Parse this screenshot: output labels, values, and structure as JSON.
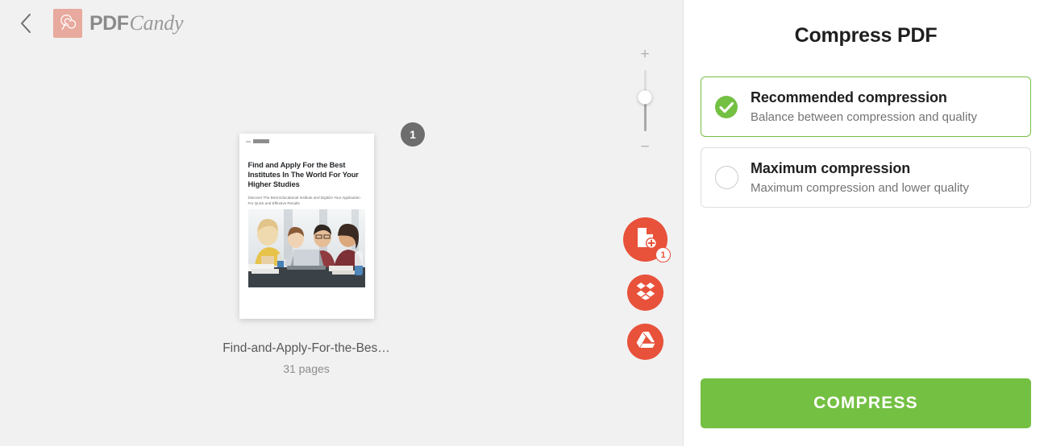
{
  "header": {
    "back_icon": "chevron-left-icon",
    "logo_icon": "lollipop-icon",
    "brand_bold": "PDF",
    "brand_italic": "Candy"
  },
  "workspace": {
    "page_badge": "1",
    "document": {
      "thumbnail_title": "Find and Apply For the Best Institutes In The World For Your Higher Studies",
      "thumbnail_subtitle": "Discover The Best Educational Institute and Digitize Your Application For Quick and Effective Results",
      "file_name": "Find-and-Apply-For-the-Bes…",
      "page_count": "31 pages"
    },
    "zoom": {
      "increase_label": "+",
      "decrease_label": "−",
      "increase_icon": "plus-icon",
      "decrease_icon": "minus-icon",
      "handle_position_percent": 45
    },
    "actions": [
      {
        "name": "add-file-button",
        "icon": "file-plus-icon",
        "badge": "1"
      },
      {
        "name": "dropbox-button",
        "icon": "dropbox-icon",
        "badge": ""
      },
      {
        "name": "google-drive-button",
        "icon": "google-drive-icon",
        "badge": ""
      }
    ]
  },
  "panel": {
    "title": "Compress PDF",
    "options": [
      {
        "title": "Recommended compression",
        "description": "Balance between compression and quality",
        "selected": true,
        "icon": "check-circle-icon"
      },
      {
        "title": "Maximum compression",
        "description": "Maximum compression and lower quality",
        "selected": false,
        "icon": "radio-unchecked-icon"
      }
    ],
    "cta_label": "COMPRESS"
  },
  "colors": {
    "accent_green": "#74c043",
    "accent_orange": "#e8513a",
    "logo_pink": "#e8a99e",
    "canvas_bg": "#f1f1f1",
    "badge_gray": "#6d6d6d"
  }
}
